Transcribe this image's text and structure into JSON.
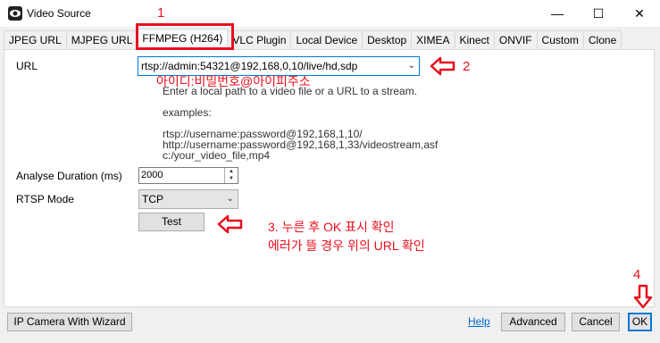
{
  "window": {
    "title": "Video Source"
  },
  "tabs": [
    {
      "label": "JPEG URL",
      "active": false
    },
    {
      "label": "MJPEG URL",
      "active": false
    },
    {
      "label": "FFMPEG (H264)",
      "active": true
    },
    {
      "label": "VLC Plugin",
      "active": false
    },
    {
      "label": "Local Device",
      "active": false
    },
    {
      "label": "Desktop",
      "active": false
    },
    {
      "label": "XIMEA",
      "active": false
    },
    {
      "label": "Kinect",
      "active": false
    },
    {
      "label": "ONVIF",
      "active": false
    },
    {
      "label": "Custom",
      "active": false
    },
    {
      "label": "Clone",
      "active": false
    }
  ],
  "form": {
    "url_label": "URL",
    "url_value": "rtsp://admin:54321@192,168,0,10/live/hd,sdp",
    "help_lines": [
      "Enter a local path to a video file or a URL to a stream.",
      "",
      "examples:",
      "",
      "rtsp://username:password@192,168,1,10/",
      "http://username:password@192,168,1,33/videostream,asf",
      "c:/your_video_file,mp4"
    ],
    "analyse_label": "Analyse Duration (ms)",
    "analyse_value": "2000",
    "rtsp_label": "RTSP Mode",
    "rtsp_value": "TCP",
    "test_label": "Test"
  },
  "annotations": {
    "n1": "1",
    "n2": "2",
    "n4": "4",
    "credential_hint": "아이디:비밀번호@아이피주소",
    "step3_line1": "3. 누른 후 OK 표시 확인",
    "step3_line2": "에러가 뜰 경우 위의 URL 확인",
    "accent": "#e8101e"
  },
  "footer": {
    "wizard_label": "IP Camera With Wizard",
    "help_label": "Help",
    "advanced_label": "Advanced",
    "cancel_label": "Cancel",
    "ok_label": "OK"
  }
}
